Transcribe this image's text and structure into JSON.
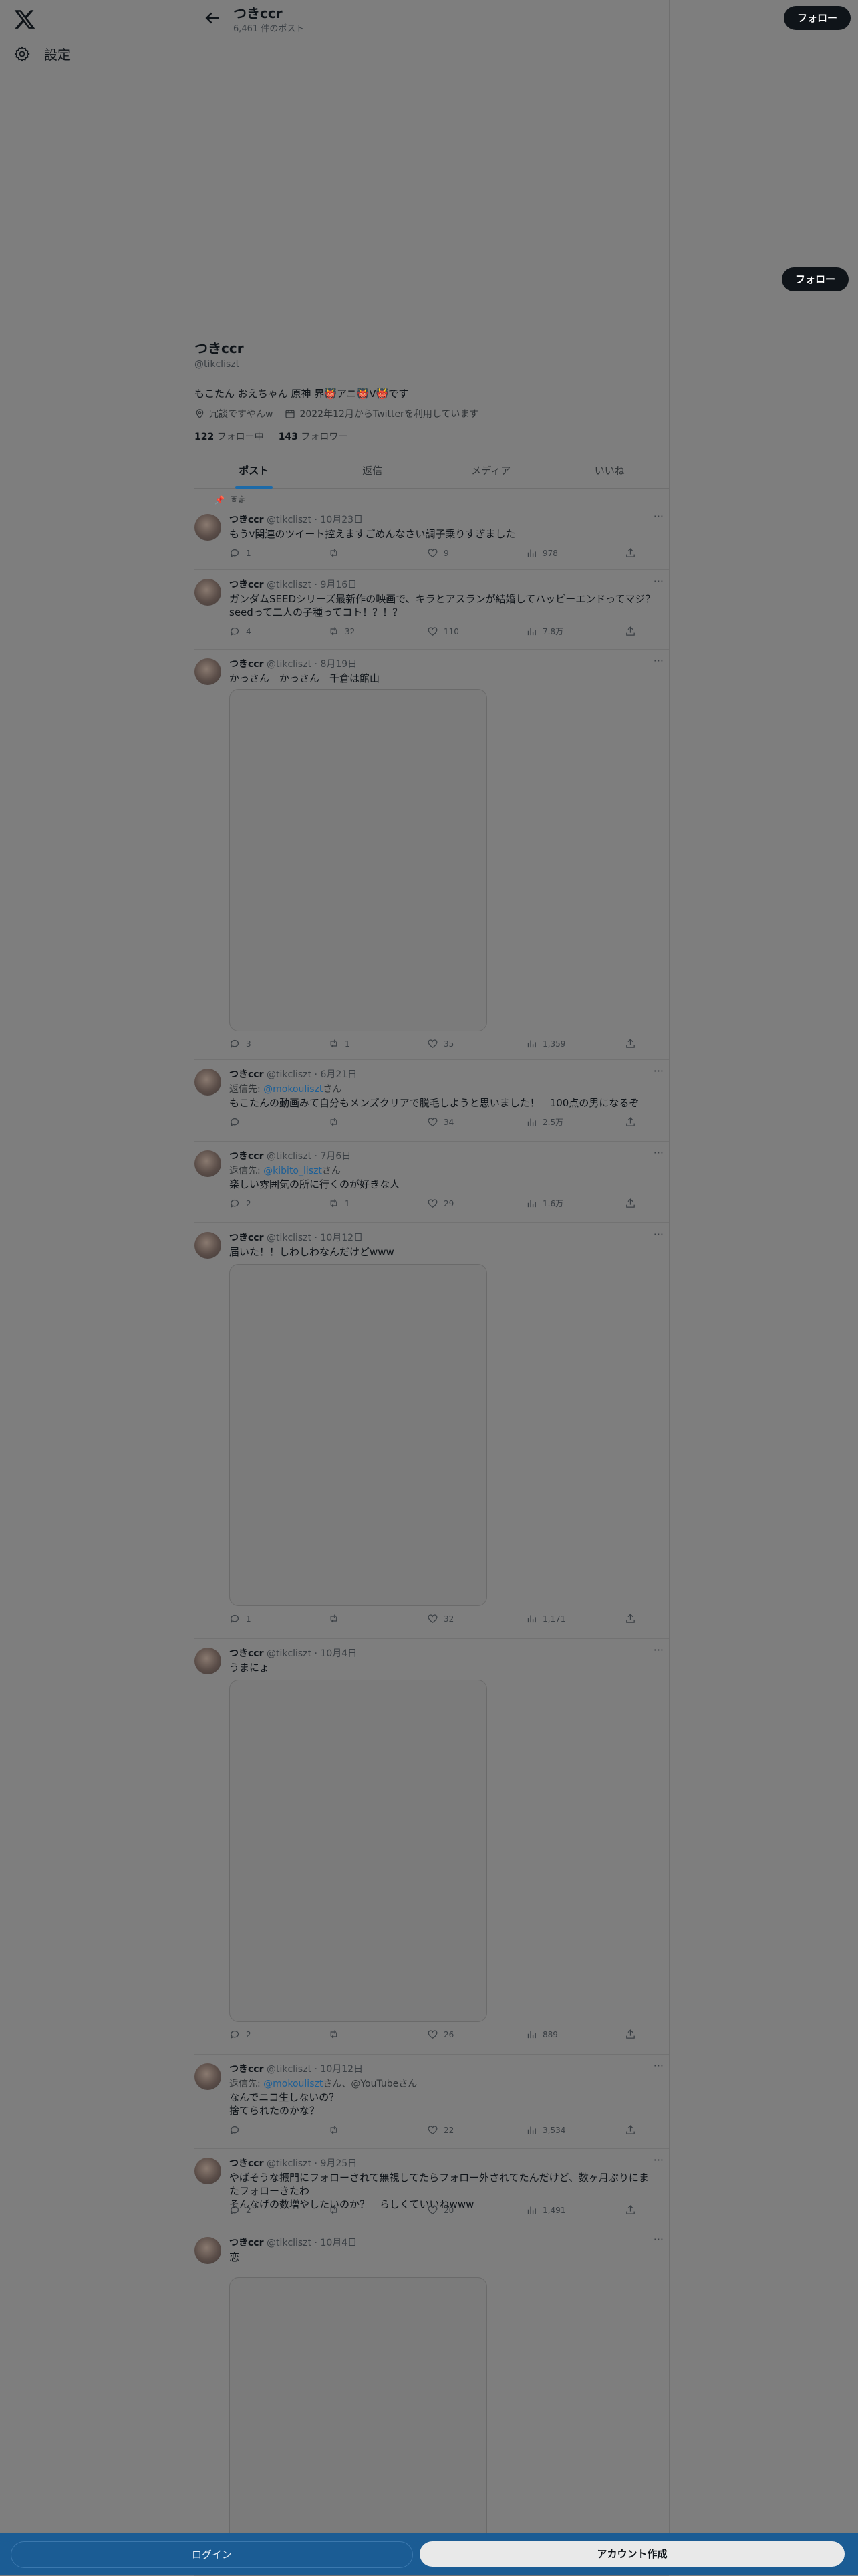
{
  "settings_label": "設定",
  "header": {
    "name": "つきccr",
    "post_count": "6,461 件のポスト",
    "follow_label": "フォロー"
  },
  "profile": {
    "name": "つきccr",
    "handle": "@tikcliszt",
    "bio": "もこたん おえちゃん 原神 界👹アニ👹V👹です",
    "location": "冗談ですやんw",
    "joined": "2022年12月からTwitterを利用しています",
    "following_count": "122",
    "following_label": "フォロー中",
    "followers_count": "143",
    "followers_label": "フォロワー",
    "follow_label": "フォロー"
  },
  "tabs": [
    "ポスト",
    "返信",
    "メディア",
    "いいね"
  ],
  "pinned_label": "固定",
  "tweets": [
    {
      "name": "つきccr",
      "handle": "@tikcliszt",
      "date": "10月23日",
      "reply_prefix": "",
      "reply_to": "",
      "reply_suffix": "",
      "text": "もうv関連のツイート控えますごめんなさい調子乗りすぎました",
      "replies": "1",
      "reposts": "",
      "likes": "9",
      "views": "978"
    },
    {
      "name": "つきccr",
      "handle": "@tikcliszt",
      "date": "9月16日",
      "reply_prefix": "",
      "reply_to": "",
      "reply_suffix": "",
      "text": "ガンダムSEEDシリーズ最新作の映画で、キラとアスランが結婚してハッピーエンドってマジ？\nseedって二人の子種ってコト！？！？",
      "replies": "4",
      "reposts": "32",
      "likes": "110",
      "views": "7.8万"
    },
    {
      "name": "つきccr",
      "handle": "@tikcliszt",
      "date": "8月19日",
      "reply_prefix": "",
      "reply_to": "",
      "reply_suffix": "",
      "text": "かっさん　かっさん　千倉は館山",
      "replies": "3",
      "reposts": "1",
      "likes": "35",
      "views": "1,359"
    },
    {
      "name": "つきccr",
      "handle": "@tikcliszt",
      "date": "6月21日",
      "reply_prefix": "返信先: ",
      "reply_to": "@mokouliszt",
      "reply_suffix": "さん",
      "text": "もこたんの動画みて自分もメンズクリアで脱毛しようと思いました！　100点の男になるぞ",
      "replies": "",
      "reposts": "",
      "likes": "34",
      "views": "2.5万"
    },
    {
      "name": "つきccr",
      "handle": "@tikcliszt",
      "date": "7月6日",
      "reply_prefix": "返信先: ",
      "reply_to": "@kibito_liszt",
      "reply_suffix": "さん",
      "text": "楽しい雰囲気の所に行くのが好きな人",
      "replies": "2",
      "reposts": "1",
      "likes": "29",
      "views": "1.6万"
    },
    {
      "name": "つきccr",
      "handle": "@tikcliszt",
      "date": "10月12日",
      "reply_prefix": "",
      "reply_to": "",
      "reply_suffix": "",
      "text": "届いた！！しわしわなんだけどwww",
      "replies": "1",
      "reposts": "",
      "likes": "32",
      "views": "1,171"
    },
    {
      "name": "つきccr",
      "handle": "@tikcliszt",
      "date": "10月4日",
      "reply_prefix": "",
      "reply_to": "",
      "reply_suffix": "",
      "text": "うまにょ",
      "replies": "2",
      "reposts": "",
      "likes": "26",
      "views": "889"
    },
    {
      "name": "つきccr",
      "handle": "@tikcliszt",
      "date": "10月12日",
      "reply_prefix": "返信先: ",
      "reply_to": "@mokouliszt",
      "reply_suffix": "さん、@YouTubeさん",
      "text": "なんでニコ生しないの？\n捨てられたのかな？",
      "replies": "",
      "reposts": "",
      "likes": "22",
      "views": "3,534"
    },
    {
      "name": "つきccr",
      "handle": "@tikcliszt",
      "date": "9月25日",
      "reply_prefix": "",
      "reply_to": "",
      "reply_suffix": "",
      "text": "やばそうな振門にフォローされて無視してたらフォロー外されてたんだけど、数ヶ月ぶりにまたフォローきたわ\nそんなげの数増やしたいのか？　らしくていいねwww",
      "replies": "2",
      "reposts": "",
      "likes": "20",
      "views": "1,491"
    },
    {
      "name": "つきccr",
      "handle": "@tikcliszt",
      "date": "10月4日",
      "reply_prefix": "",
      "reply_to": "",
      "reply_suffix": "",
      "text": "恋",
      "replies": "",
      "reposts": "",
      "likes": "",
      "views": ""
    }
  ],
  "bottom": {
    "login_label": "ログイン",
    "signup_label": "アカウント作成"
  },
  "colors": {
    "overlay": "#7e7e7e",
    "bottom_bar": "#1b5c94",
    "link": "#1d5f96"
  }
}
